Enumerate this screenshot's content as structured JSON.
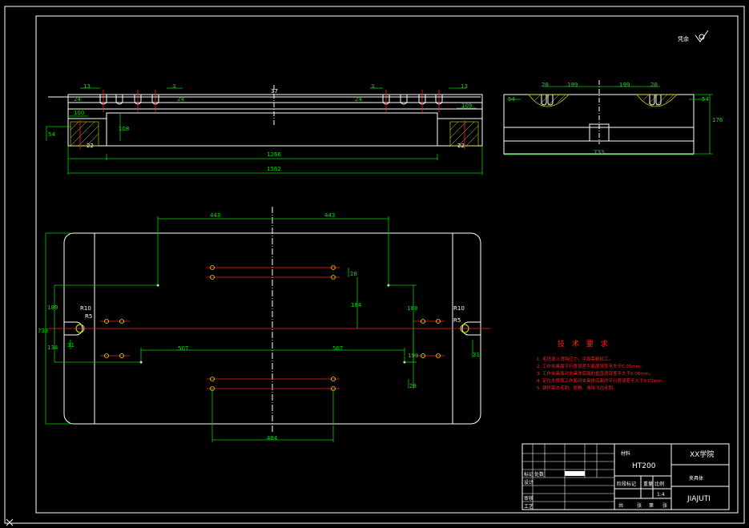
{
  "corner_mark": "凭余",
  "front_view_dims": {
    "d13_left": "13",
    "d3_left": "3",
    "d37": "37",
    "d3_right": "3",
    "d13_right": "13",
    "d24_l1": "24",
    "d24_l2": "24",
    "d24_r1": "24",
    "d100_left": "100",
    "d109_right": "109",
    "d54": "54",
    "d108": "108",
    "d1266": "1266",
    "d1562": "1562",
    "d22_left": "22",
    "d22_right": "22"
  },
  "side_view_dims": {
    "d28_l": "28",
    "d199_l": "199",
    "d199_r": "199",
    "d28_r": "28",
    "d54_l": "54",
    "d54_r": "54",
    "d176": "176",
    "d733": "733"
  },
  "plan_view_dims": {
    "d443_l": "443",
    "d443_r": "443",
    "d733": "733",
    "d189_l": "189",
    "d134": "134",
    "d184": "184",
    "d188_r": "188",
    "r10_l": "R10",
    "r5_l": "R5",
    "r10_r": "R10",
    "r5_r": "R5",
    "d31_l": "31",
    "d31_r": "31",
    "d507_l": "507",
    "d507_r": "507",
    "d28_top": "28",
    "d28_bot": "28",
    "d199": "199",
    "d484": "484"
  },
  "tech_requirements": {
    "title": "技 术 要 求",
    "items": [
      "1. 毛坯退火消除应力，平面需精加工。",
      "2. 工作夹具面平行度误差平面度误差不大于0.05mm。",
      "3. 工作夹具面对夹具体底面的垂直度误差不大于0.06mm。",
      "4. 定位支撑面工作面对夹具体底面的平行度误差不大于0.02mm。",
      "5. 铸件需去毛刺、倒角、清除飞边毛刺。"
    ]
  },
  "title_block": {
    "material_label": "材料",
    "material": "HT200",
    "school": "XX学院",
    "part_name": "夹具体",
    "scale": "1:4",
    "drawing_no": "JIAJUTI",
    "row_labels": [
      "标记",
      "处数",
      "设计",
      "审核",
      "工艺"
    ],
    "stage_label": "阶段标记",
    "weight_label": "重量",
    "scale_label": "比例",
    "sheet_labels": [
      "共",
      "张",
      "第",
      "张"
    ]
  }
}
